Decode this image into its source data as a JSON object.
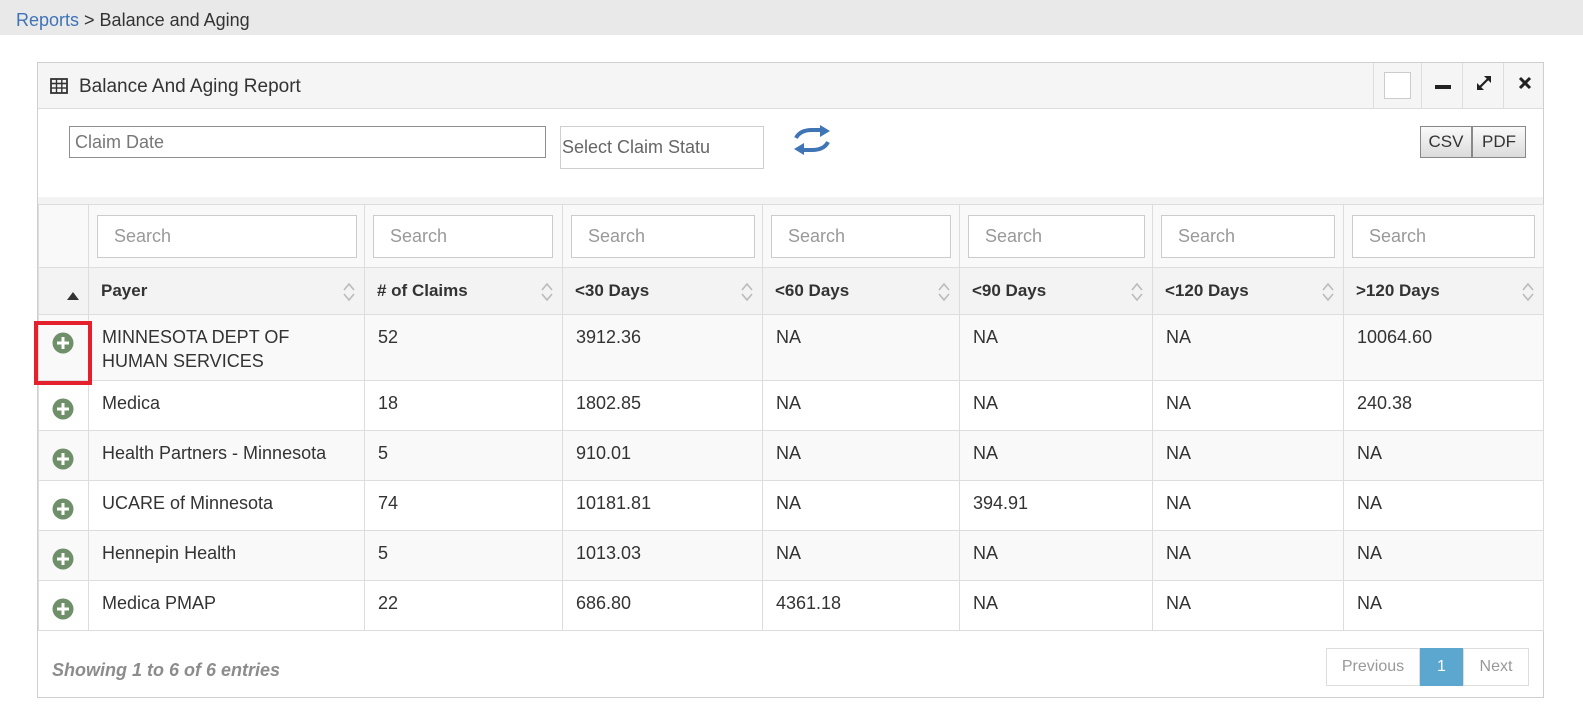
{
  "breadcrumb": {
    "parent": "Reports",
    "separator": ">",
    "current": "Balance and Aging"
  },
  "widget": {
    "title": "Balance And Aging Report",
    "icons": {
      "title": "table-icon",
      "minimize": "minus-icon",
      "expand": "expand-icon",
      "close": "close-icon"
    }
  },
  "filters": {
    "claim_date_placeholder": "Claim Date",
    "claim_status_placeholder": "Select Claim Statu",
    "refresh_icon": "refresh-icon",
    "csv_label": "CSV",
    "pdf_label": "PDF"
  },
  "table": {
    "search_placeholder": "Search",
    "columns": [
      "Payer",
      "# of Claims",
      "<30 Days",
      "<60 Days",
      "<90 Days",
      "<120 Days",
      ">120 Days"
    ],
    "rows": [
      [
        "MINNESOTA DEPT OF HUMAN SERVICES",
        "52",
        "3912.36",
        "NA",
        "NA",
        "NA",
        "10064.60"
      ],
      [
        "Medica",
        "18",
        "1802.85",
        "NA",
        "NA",
        "NA",
        "240.38"
      ],
      [
        "Health Partners - Minnesota",
        "5",
        "910.01",
        "NA",
        "NA",
        "NA",
        "NA"
      ],
      [
        "UCARE of Minnesota",
        "74",
        "10181.81",
        "NA",
        "394.91",
        "NA",
        "NA"
      ],
      [
        "Hennepin Health",
        "5",
        "1013.03",
        "NA",
        "NA",
        "NA",
        "NA"
      ],
      [
        "Medica PMAP",
        "22",
        "686.80",
        "4361.18",
        "NA",
        "NA",
        "NA"
      ]
    ]
  },
  "footer": {
    "info": "Showing 1 to 6 of 6 entries",
    "previous": "Previous",
    "page": "1",
    "next": "Next"
  },
  "colors": {
    "link": "#3f74b5",
    "plus_icon": "#6f8f6a",
    "highlight": "#e3202b",
    "pager_active": "#5ba7cf"
  }
}
